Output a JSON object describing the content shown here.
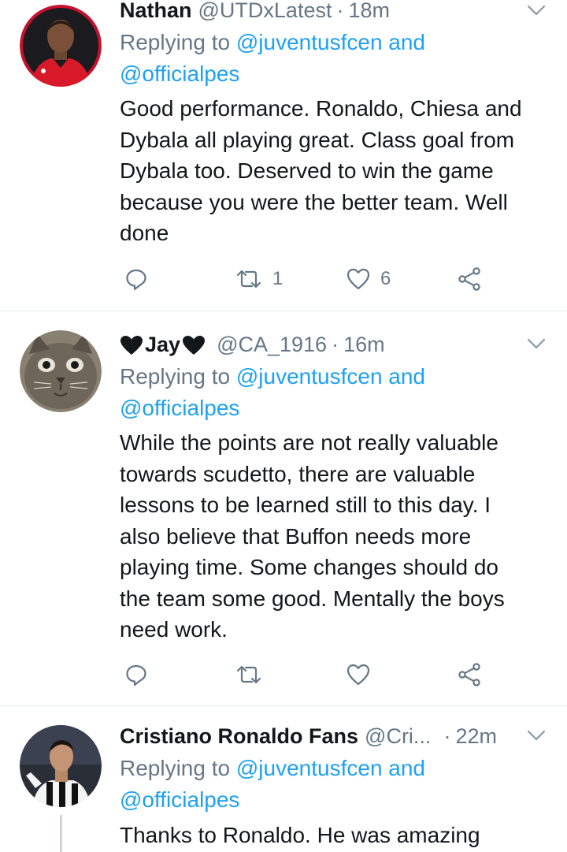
{
  "tweets": [
    {
      "name": "Nathan",
      "handle": "@UTDxLatest",
      "sep": "·",
      "time": "18m",
      "replying_prefix": "Replying to ",
      "replying_link1": "@juventusfcen and",
      "replying_link2": "@officialpes",
      "body": [
        "Good performance. Ronaldo, Chiesa and",
        "Dybala all playing great. Class goal from",
        "Dybala too. Deserved to win the game",
        "because you were the better team. Well",
        "done"
      ],
      "retweets": "1",
      "likes": "6",
      "avatar_icon": "player-red-kit-avatar"
    },
    {
      "name": "Jay",
      "handle": "@CA_1916",
      "sep": "·",
      "time": "16m",
      "replying_prefix": "Replying to ",
      "replying_link1": "@juventusfcen and",
      "replying_link2": "@officialpes",
      "body": [
        "While the points are not really valuable",
        "towards scudetto, there are valuable",
        "lessons to be learned still to this day. I",
        "also believe that Buffon needs more",
        "playing time. Some changes should do",
        "the team some good. Mentally the boys",
        "need work."
      ],
      "retweets": "",
      "likes": "",
      "avatar_icon": "cat-avatar"
    },
    {
      "name": "Cristiano Ronaldo Fans",
      "handle": "@Cri...",
      "sep": "·",
      "time": "22m",
      "replying_prefix": "Replying to ",
      "replying_link1": "@juventusfcen and",
      "replying_link2": "@officialpes",
      "body": [
        "Thanks to Ronaldo. He was amazing"
      ],
      "avatar_icon": "ronaldo-juventus-avatar"
    }
  ],
  "colors": {
    "text": "#14171a",
    "muted": "#657786",
    "link": "#1da1f2",
    "divider": "#e1e8ed"
  }
}
